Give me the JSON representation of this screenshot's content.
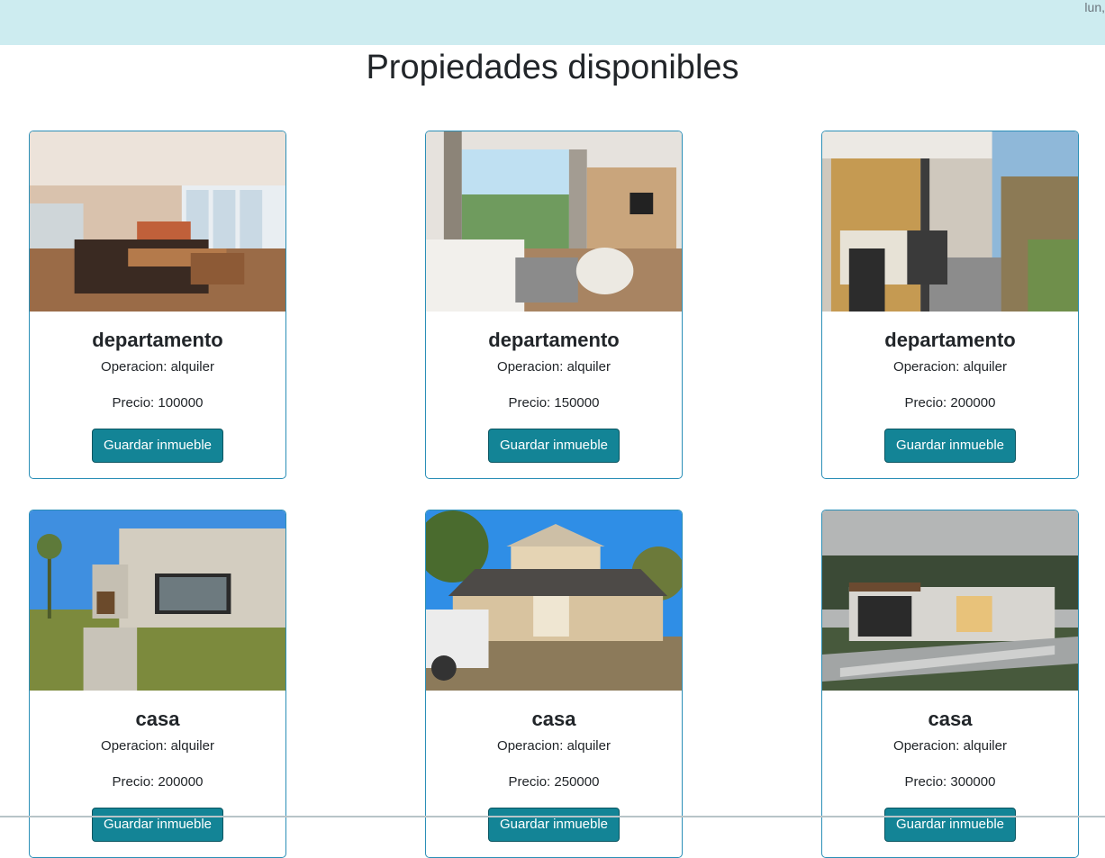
{
  "header": {
    "date_text": "lun,",
    "background": "#cdecf0"
  },
  "page": {
    "title": "Propiedades disponibles"
  },
  "labels": {
    "operation": "Operacion:",
    "price": "Precio:",
    "save_button": "Guardar inmueble"
  },
  "properties": [
    {
      "type": "departamento",
      "operation": "alquiler",
      "price": "100000",
      "photo": "living-room-photo"
    },
    {
      "type": "departamento",
      "operation": "alquiler",
      "price": "150000",
      "photo": "living-room-balcony-photo"
    },
    {
      "type": "departamento",
      "operation": "alquiler",
      "price": "200000",
      "photo": "balcony-photo"
    },
    {
      "type": "casa",
      "operation": "alquiler",
      "price": "200000",
      "photo": "modern-house-photo"
    },
    {
      "type": "casa",
      "operation": "alquiler",
      "price": "250000",
      "photo": "two-story-house-photo"
    },
    {
      "type": "casa",
      "operation": "alquiler",
      "price": "300000",
      "photo": "single-story-house-photo"
    }
  ],
  "colors": {
    "accent_button": "#138496",
    "card_border": "#2b8fb7"
  }
}
